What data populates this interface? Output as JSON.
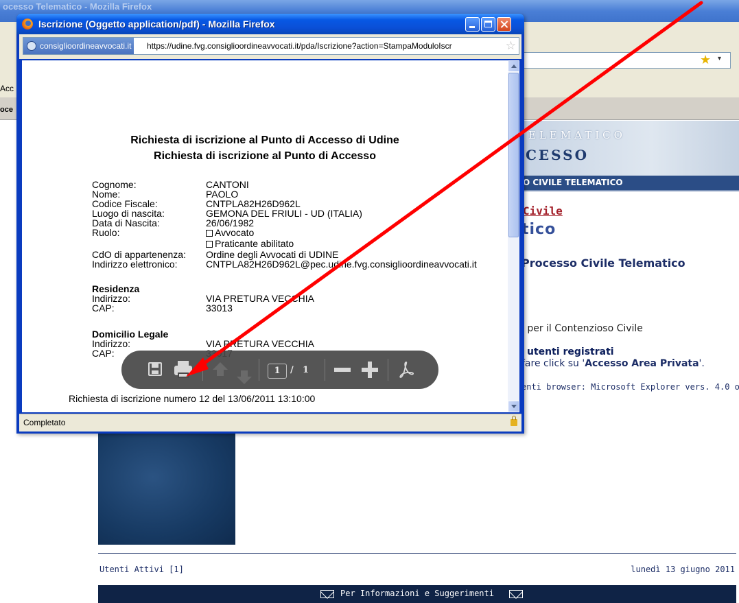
{
  "background": {
    "window_title": "ocesso Telematico - Mozilla Firefox",
    "bookmark_partial": "Acc",
    "tab_partial": "oce",
    "banner_line1": "ELEMATICO",
    "banner_line2": "CESSO",
    "nav_strip": "O CIVILE TELEMATICO",
    "logo_civile": "Civile",
    "logo_tico": "tico",
    "heading": "Processo Civile Telematico",
    "contenzioso": "i per il Contenzioso Civile",
    "utenti_registrati": "utenti registrati",
    "click_prefix": "fare click su '",
    "click_link": "Accesso Area Privata",
    "click_suffix": "'.",
    "browser_note": "enti browser: Microsoft Explorer vers. 4.0 o",
    "utenti_attivi": "Utenti Attivi [1]",
    "date": "lunedì 13 giugno 2011",
    "footer": "Per Informazioni e Suggerimenti"
  },
  "popup": {
    "title": "Iscrizione (Oggetto application/pdf) - Mozilla Firefox",
    "site_identity": "consiglioordineavvocati.it",
    "url": "https://udine.fvg.consiglioordineavvocati.it/pda/Iscrizione?action=StampaModuloIscr",
    "status": "Completato"
  },
  "pdf": {
    "title1": "Richiesta di iscrizione al Punto di Accesso di Udine",
    "title2": "Richiesta di iscrizione al Punto di Accesso",
    "fields": [
      {
        "label": "Cognome:",
        "value": "CANTONI"
      },
      {
        "label": "Nome:",
        "value": "PAOLO"
      },
      {
        "label": "Codice Fiscale:",
        "value": "CNTPLA82H26D962L"
      },
      {
        "label": "Luogo di nascita:",
        "value": "GEMONA DEL FRIULI - UD (ITALIA)"
      },
      {
        "label": "Data di Nascita:",
        "value": "26/06/1982"
      },
      {
        "label": "Ruolo:",
        "value": "Avvocato"
      }
    ],
    "ruolo_option2": "Praticante abilitato",
    "cdo_label": "CdO di appartenenza:",
    "cdo_value": "Ordine degli Avvocati di UDINE",
    "email_label": "Indirizzo elettronico:",
    "email_value": "CNTPLA82H26D962L@pec.udine.fvg.consiglioordineavvocati.it",
    "residenza_heading": "Residenza",
    "res_indirizzo_label": "Indirizzo:",
    "res_indirizzo_value": "VIA PRETURA VECCHIA",
    "res_cap_label": "CAP:",
    "res_cap_value": "33013",
    "domicilio_heading": "Domicilio Legale",
    "dom_indirizzo_label": "Indirizzo:",
    "dom_indirizzo_value": "VIA PRETURA VECCHIA",
    "dom_cap_label": "CAP:",
    "dom_cap_value": "33017",
    "footer_note": "Richiesta di iscrizione numero 12 del 13/06/2011 13:10:00"
  },
  "pdf_toolbar": {
    "current_page": "1",
    "separator": "/",
    "total_pages": "1"
  },
  "colors": {
    "annotation_arrow": "#ff0000",
    "navy": "#1c2d66"
  }
}
